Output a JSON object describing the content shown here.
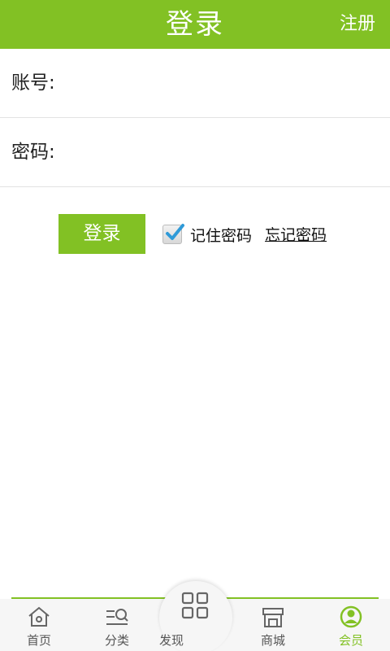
{
  "header": {
    "title": "登录",
    "register_label": "注册"
  },
  "form": {
    "account_label": "账号:",
    "account_value": "",
    "password_label": "密码:",
    "password_value": ""
  },
  "actions": {
    "login_label": "登录",
    "remember_label": "记住密码",
    "remember_checked": true,
    "forgot_label": "忘记密码"
  },
  "bottom_nav": {
    "items": [
      {
        "label": "首页",
        "icon": "home-icon",
        "active": false
      },
      {
        "label": "分类",
        "icon": "category-search-icon",
        "active": false
      },
      {
        "label": "发现",
        "icon": "grid-icon",
        "active": false
      },
      {
        "label": "商城",
        "icon": "store-icon",
        "active": false
      },
      {
        "label": "会员",
        "icon": "user-icon",
        "active": true
      }
    ]
  },
  "colors": {
    "accent": "#82c124",
    "nav_bg": "#f6f6f6",
    "text": "#222222"
  }
}
